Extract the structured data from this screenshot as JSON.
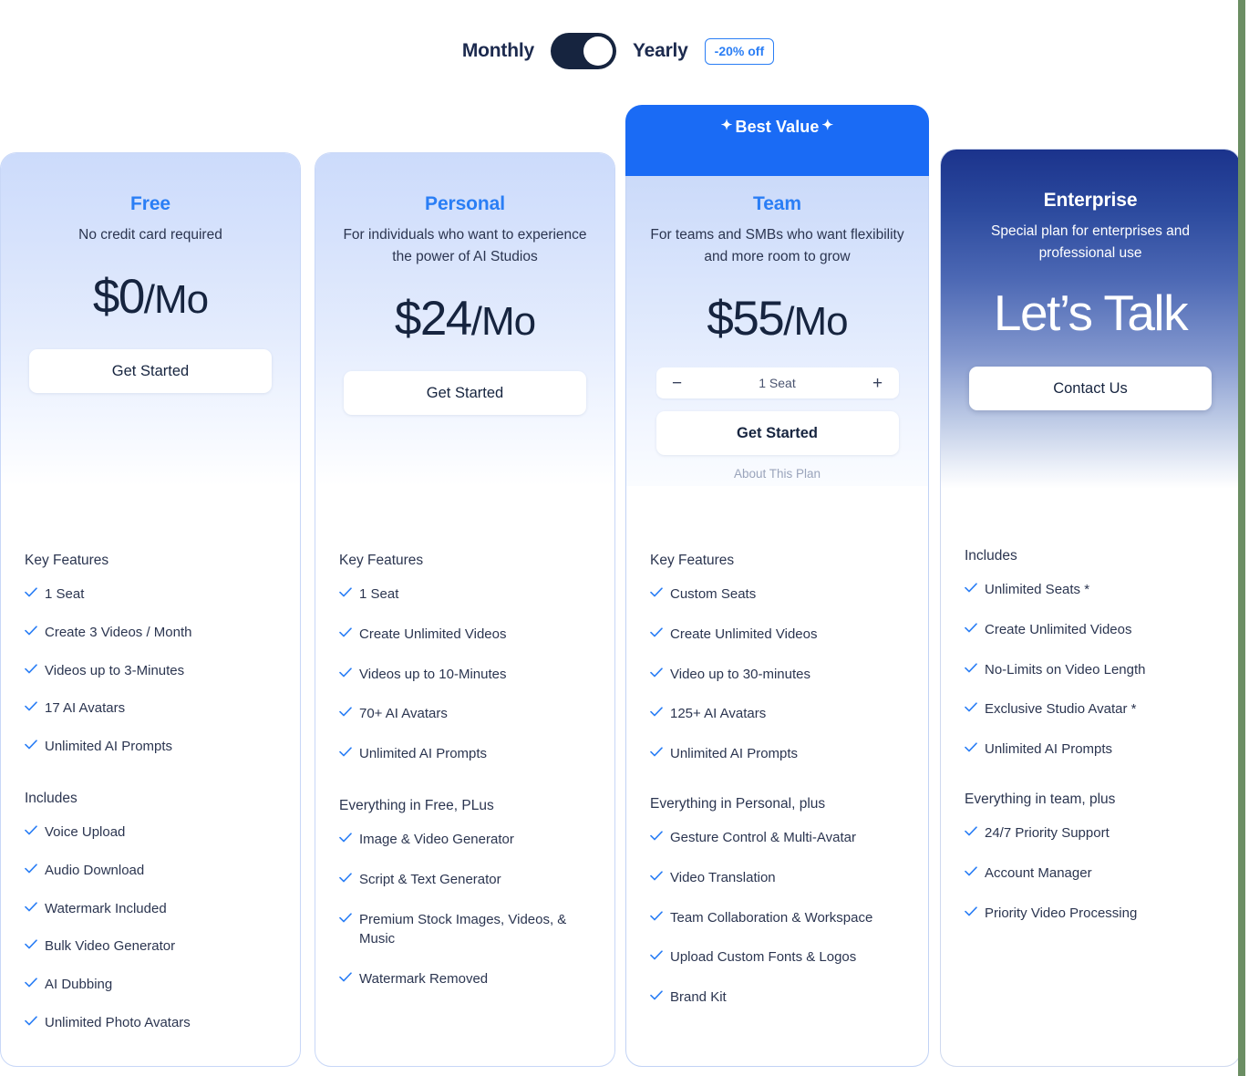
{
  "billing_toggle": {
    "monthly_label": "Monthly",
    "yearly_label": "Yearly",
    "discount_badge": "-20% off",
    "active": "Yearly"
  },
  "best_value_banner": {
    "label": "Best Value",
    "spark_left": "✦",
    "spark_right": "✦",
    "background": "#1a6bf5"
  },
  "accent_color": "#2a7ef5",
  "plans": {
    "free": {
      "name": "Free",
      "description": "No credit card required",
      "price": "$0",
      "price_unit": "/Mo",
      "cta": "Get Started",
      "groups": [
        {
          "title": "Key Features",
          "items": [
            "1 Seat",
            "Create 3 Videos / Month",
            "Videos up to 3-Minutes",
            "17 AI Avatars",
            "Unlimited AI Prompts"
          ]
        },
        {
          "title": "Includes",
          "items": [
            "Voice Upload",
            "Audio Download",
            "Watermark Included",
            "Bulk Video Generator",
            "AI Dubbing",
            "Unlimited Photo Avatars"
          ]
        }
      ]
    },
    "personal": {
      "name": "Personal",
      "description": "For individuals who want to experience the power of AI Studios",
      "price": "$24",
      "price_unit": "/Mo",
      "cta": "Get Started",
      "groups": [
        {
          "title": "Key Features",
          "items": [
            "1 Seat",
            "Create Unlimited Videos",
            "Videos up to 10-Minutes",
            "70+ AI Avatars",
            "Unlimited AI Prompts"
          ]
        },
        {
          "title": "Everything in Free, PLus",
          "items": [
            "Image & Video Generator",
            "Script & Text Generator",
            "Premium Stock Images, Videos, & Music",
            "Watermark Removed"
          ]
        }
      ]
    },
    "team": {
      "name": "Team",
      "description": "For teams and SMBs who want flexibility and more room to grow",
      "price": "$55",
      "price_unit": "/Mo",
      "seat_count": "1 Seat",
      "seat_decrement": "−",
      "seat_increment": "+",
      "cta": "Get Started",
      "about_link": "About This Plan",
      "groups": [
        {
          "title": "Key Features",
          "items": [
            "Custom Seats",
            "Create Unlimited Videos",
            "Video up to 30-minutes",
            "125+ AI Avatars",
            "Unlimited AI Prompts"
          ]
        },
        {
          "title": "Everything in Personal, plus",
          "items": [
            "Gesture Control & Multi-Avatar",
            "Video Translation",
            "Team Collaboration & Workspace",
            "Upload Custom Fonts & Logos",
            "Brand Kit"
          ]
        }
      ]
    },
    "enterprise": {
      "name": "Enterprise",
      "description": "Special plan for enterprises and professional use",
      "price": "Let’s Talk",
      "cta": "Contact Us",
      "groups": [
        {
          "title": "Includes",
          "items": [
            "Unlimited Seats *",
            "Create Unlimited Videos",
            "No-Limits on Video Length",
            "Exclusive Studio Avatar *",
            "Unlimited AI Prompts"
          ]
        },
        {
          "title": "Everything in team, plus",
          "items": [
            "24/7 Priority Support",
            "Account Manager",
            "Priority Video Processing"
          ]
        }
      ]
    }
  }
}
